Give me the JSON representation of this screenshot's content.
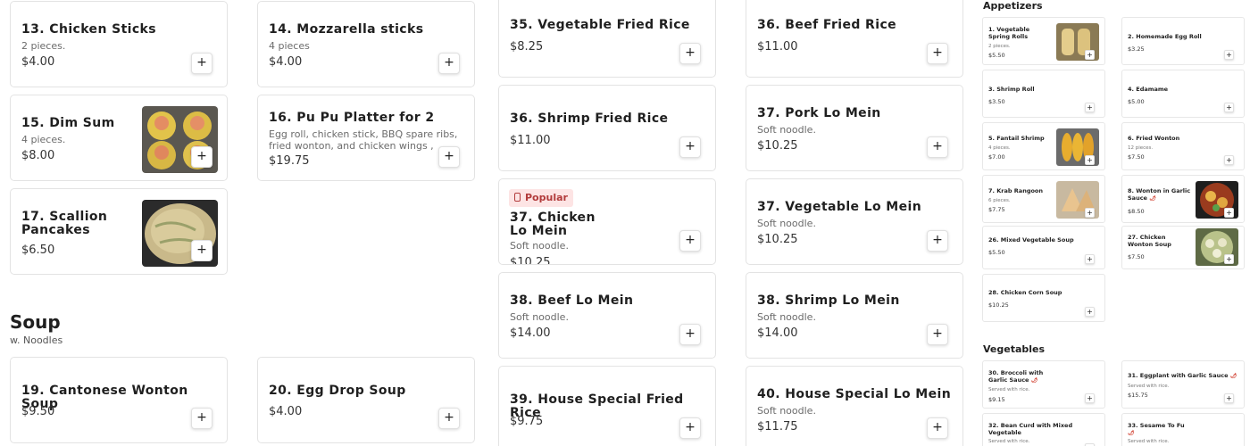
{
  "col1": [
    {
      "name": "13. Chicken Sticks",
      "desc": "2 pieces.",
      "price": "$4.00"
    },
    {
      "name": "15. Dim Sum",
      "desc": "4 pieces.",
      "price": "$8.00"
    },
    {
      "name": "17. Scallion Pancakes",
      "price": "$6.50"
    }
  ],
  "col2": [
    {
      "name": "14. Mozzarella sticks",
      "desc": "4 pieces",
      "price": "$4.00"
    },
    {
      "name": "16. Pu Pu Platter for 2",
      "desc": "Egg roll, chicken stick, BBQ spare ribs, fried wonton, and chicken wings , cheese wonton",
      "price": "$19.75"
    }
  ],
  "soup_section": {
    "title": "Soup",
    "subtitle": "w. Noodles"
  },
  "soups": [
    {
      "name": "19. Cantonese Wonton Soup",
      "price": "$9.50"
    },
    {
      "name": "20. Egg Drop Soup",
      "price": "$4.00"
    }
  ],
  "col3": [
    {
      "name": "35. Vegetable Fried Rice",
      "price": "$8.25"
    },
    {
      "name": "36. Shrimp Fried Rice",
      "price": "$11.00"
    },
    {
      "badge": "Popular",
      "name": "37. Chicken Lo Mein",
      "desc": "Soft noodle.",
      "price": "$10.25"
    },
    {
      "name": "38. Beef Lo Mein",
      "desc": "Soft noodle.",
      "price": "$14.00"
    },
    {
      "name": "39. House Special Fried Rice",
      "price": "$9.75"
    }
  ],
  "col4": [
    {
      "name": "36. Beef Fried Rice",
      "price": "$11.00"
    },
    {
      "name": "37. Pork Lo Mein",
      "desc": "Soft noodle.",
      "price": "$10.25"
    },
    {
      "name": "37. Vegetable Lo Mein",
      "desc": "Soft noodle.",
      "price": "$10.25"
    },
    {
      "name": "38. Shrimp Lo Mein",
      "desc": "Soft noodle.",
      "price": "$14.00"
    },
    {
      "name": "40. House Special Lo Mein",
      "desc": "Soft noodle.",
      "price": "$11.75"
    }
  ],
  "add_symbol": "+",
  "right": {
    "appetizers_title": "Appetizers",
    "vegetables_title": "Vegetables",
    "chili_symbol": "🌶",
    "appetizers": [
      {
        "name": "1. Vegetable Spring Rolls",
        "desc": "2 pieces.",
        "price": "$5.50"
      },
      {
        "name": "2. Homemade Egg Roll",
        "price": "$3.25"
      },
      {
        "name": "3. Shrimp Roll",
        "price": "$3.50"
      },
      {
        "name": "4. Edamame",
        "price": "$5.00"
      },
      {
        "name": "5. Fantail Shrimp",
        "desc": "4 pieces.",
        "price": "$7.00"
      },
      {
        "name": "6. Fried Wonton",
        "desc": "12 pieces.",
        "price": "$7.50"
      },
      {
        "name": "7. Krab Rangoon",
        "desc": "6 pieces.",
        "price": "$7.75"
      },
      {
        "name": "8. Wonton in Garlic Sauce",
        "price": "$8.50"
      },
      {
        "name": "26. Mixed Vegetable Soup",
        "price": "$5.50"
      },
      {
        "name": "27. Chicken Wonton Soup",
        "price": "$7.50"
      },
      {
        "name": "28. Chicken Corn Soup",
        "price": "$10.25"
      }
    ],
    "vegetables": [
      {
        "name": "30. Broccoli with Garlic Sauce",
        "desc": "Served with rice.",
        "price": "$9.15"
      },
      {
        "name": "31. Eggplant with Garlic Sauce",
        "desc": "Served with rice.",
        "price": "$15.75"
      },
      {
        "name": "32. Bean Curd with Mixed Vegetable",
        "desc": "Served with rice."
      },
      {
        "name": "33. Sesame To Fu",
        "desc": "Served with rice."
      }
    ]
  }
}
